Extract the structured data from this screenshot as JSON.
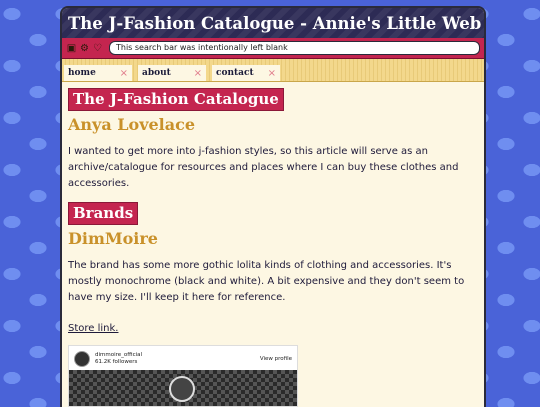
{
  "window": {
    "title": "The J-Fashion Catalogue - Annie's Little Web"
  },
  "toolbar": {
    "icons": [
      "window-icon",
      "cog-icon",
      "heart-icon"
    ],
    "search_text": "This search bar was intentionally left blank"
  },
  "tabs": [
    {
      "label": "home",
      "close": "×"
    },
    {
      "label": "about",
      "close": "×"
    },
    {
      "label": "contact",
      "close": "×"
    }
  ],
  "content": {
    "heading1": "The J-Fashion Catalogue",
    "author": "Anya Lovelace",
    "intro": "I wanted to get more into j-fashion styles, so this article will serve as an archive/catalogue for resources and places where I can buy these clothes and accessories.",
    "heading2": "Brands",
    "brand_name": "DimMoire",
    "brand_desc": "The brand has some more gothic lolita kinds of clothing and accessories. It's mostly monochrome (black and white). A bit expensive and they don't seem to have my size. I'll keep it here for reference.",
    "store_link": "Store link.",
    "embed": {
      "username": "dimmoire_official",
      "followers": "61.2K followers",
      "view_profile": "View profile"
    }
  },
  "colors": {
    "accent": "#c4254f",
    "gold": "#c9912a",
    "titlebar": "#2d2b55",
    "page_bg": "#fdf7e3",
    "desktop": "#4a63d8"
  }
}
